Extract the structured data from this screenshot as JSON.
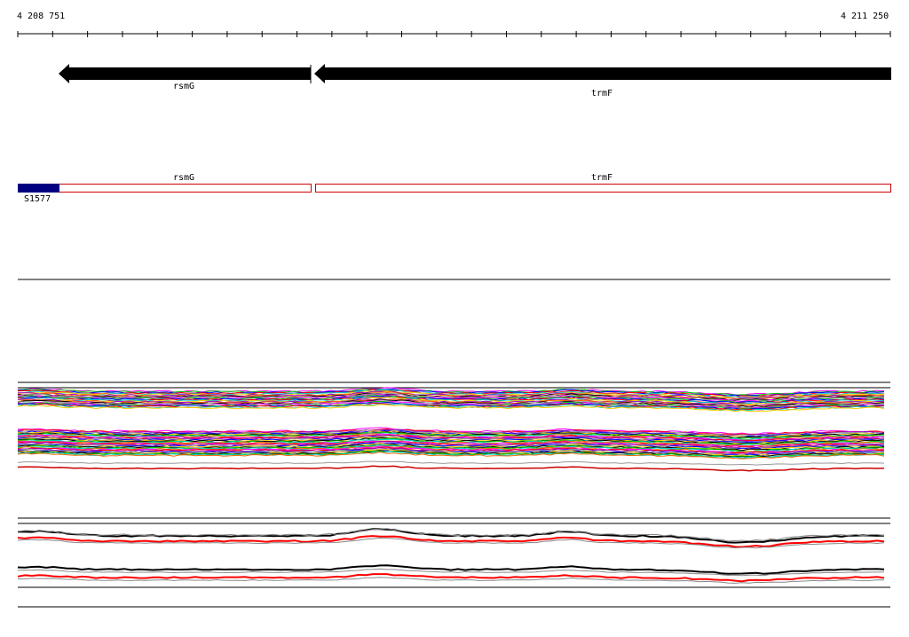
{
  "ruler": {
    "start_label": "4 208 751",
    "end_label": "4 211 250",
    "start": 4208751,
    "end": 4211250
  },
  "genes": [
    {
      "name": "rsmG",
      "strand": "-"
    },
    {
      "name": "trmF",
      "strand": "-"
    }
  ],
  "cds_track": {
    "features": [
      {
        "name": "rsmG",
        "color": "#cc0000"
      },
      {
        "name": "trmF",
        "color": "#cc0000"
      }
    ],
    "highlight": {
      "label": "S1577",
      "color": "#000080"
    }
  },
  "colors": {
    "gene_arrow": "#000000",
    "cds_outline": "#cc0000",
    "highlight_fill": "#000080",
    "profile_palette": [
      "#ff00ff",
      "#00cc00",
      "#0000ff",
      "#ff0000",
      "#00cccc",
      "#ffcc00",
      "#9900cc",
      "#ff6600",
      "#000000",
      "#999999"
    ],
    "expression_series": [
      "#000000",
      "#ff0000",
      "#888888"
    ]
  }
}
